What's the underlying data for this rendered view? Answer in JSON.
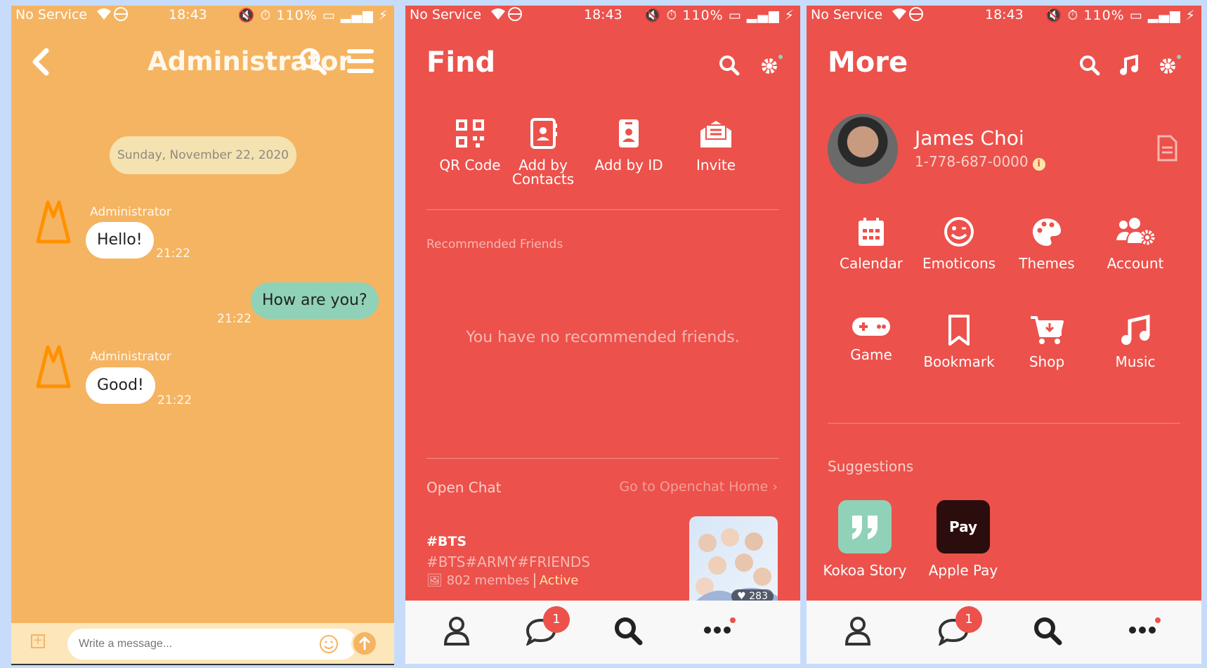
{
  "status_bar": {
    "carrier": "No Service",
    "time": "18:43",
    "battery": "110%"
  },
  "chat": {
    "title": "Administrator",
    "date": "Sunday, November 22, 2020",
    "messages": [
      {
        "sender": "Administrator",
        "text": "Hello!",
        "time": "21:22",
        "dir": "in"
      },
      {
        "sender": "",
        "text": "How are you?",
        "time": "21:22",
        "dir": "out"
      },
      {
        "sender": "Administrator",
        "text": "Good!",
        "time": "21:22",
        "dir": "in"
      }
    ],
    "input_placeholder": "Write a message..."
  },
  "find": {
    "title": "Find",
    "actions": [
      {
        "label": "QR Code",
        "icon": "qr-code-icon"
      },
      {
        "label": "Add by Contacts",
        "icon": "contacts-book-icon"
      },
      {
        "label": "Add by ID",
        "icon": "id-badge-icon"
      },
      {
        "label": "Invite",
        "icon": "mail-open-icon"
      }
    ],
    "recommended_label": "Recommended Friends",
    "empty_message": "You have no recommended friends.",
    "open_chat_label": "Open Chat",
    "open_chat_link": "Go to Openchat Home",
    "open_chat_item": {
      "title": "#BTS",
      "tags": "#BTS#ARMY#FRIENDS",
      "members": "802 membes",
      "status": "Active",
      "likes": "283"
    }
  },
  "more": {
    "title": "More",
    "profile": {
      "name": "James Choi",
      "phone": "1-778-687-0000"
    },
    "grid": [
      {
        "label": "Calendar",
        "icon": "calendar-icon"
      },
      {
        "label": "Emoticons",
        "icon": "smiley-icon"
      },
      {
        "label": "Themes",
        "icon": "palette-icon"
      },
      {
        "label": "Account",
        "icon": "users-gear-icon"
      },
      {
        "label": "Game",
        "icon": "gamepad-icon"
      },
      {
        "label": "Bookmark",
        "icon": "bookmark-icon"
      },
      {
        "label": "Shop",
        "icon": "cart-icon"
      },
      {
        "label": "Music",
        "icon": "music-note-icon"
      }
    ],
    "suggestions_label": "Suggestions",
    "suggestions": [
      {
        "label": "Kokoa Story",
        "icon": "quote-icon",
        "color": "#8fd2b7"
      },
      {
        "label": "Apple Pay",
        "icon": "apple-pay-icon",
        "color": "#2b0d0d",
        "tile_text": "Pay"
      }
    ]
  },
  "tabbar": {
    "chat_badge": "1"
  },
  "colors": {
    "chat_bg": "#f5b462",
    "app_red": "#ec514b",
    "outgoing_bubble": "#8fd2b7"
  }
}
